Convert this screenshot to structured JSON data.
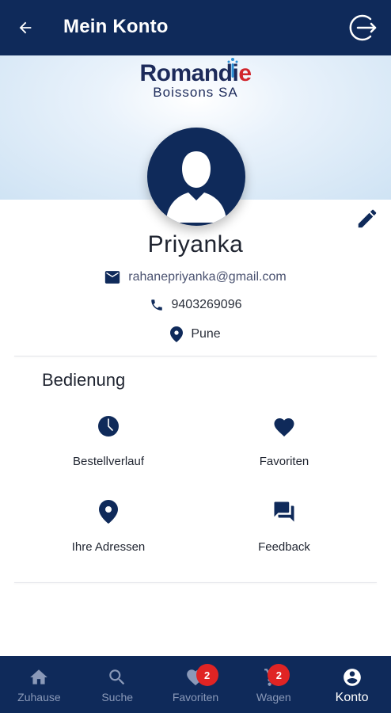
{
  "appbar": {
    "title": "Mein Konto"
  },
  "brand": {
    "name_part1": "Romandi",
    "name_part2": "e",
    "subtitle": "Boissons SA",
    "accent_color": "#d1262d",
    "primary_color": "#0f2a5a"
  },
  "profile": {
    "name": "Priyanka",
    "email": "rahanepriyanka@gmail.com",
    "phone": "9403269096",
    "location": "Pune"
  },
  "section": {
    "title": "Bedienung"
  },
  "actions": [
    {
      "label": "Bestellverlauf",
      "icon": "clock-icon"
    },
    {
      "label": "Favoriten",
      "icon": "heart-icon"
    },
    {
      "label": "Ihre Adressen",
      "icon": "location-pin-icon"
    },
    {
      "label": "Feedback",
      "icon": "chat-icon"
    }
  ],
  "bottom_nav": [
    {
      "label": "Zuhause",
      "icon": "home-icon",
      "active": false
    },
    {
      "label": "Suche",
      "icon": "search-icon",
      "active": false
    },
    {
      "label": "Favoriten",
      "icon": "heart-icon",
      "active": false,
      "badge": "2"
    },
    {
      "label": "Wagen",
      "icon": "cart-icon",
      "active": false,
      "badge": "2"
    },
    {
      "label": "Konto",
      "icon": "account-icon",
      "active": true
    }
  ]
}
